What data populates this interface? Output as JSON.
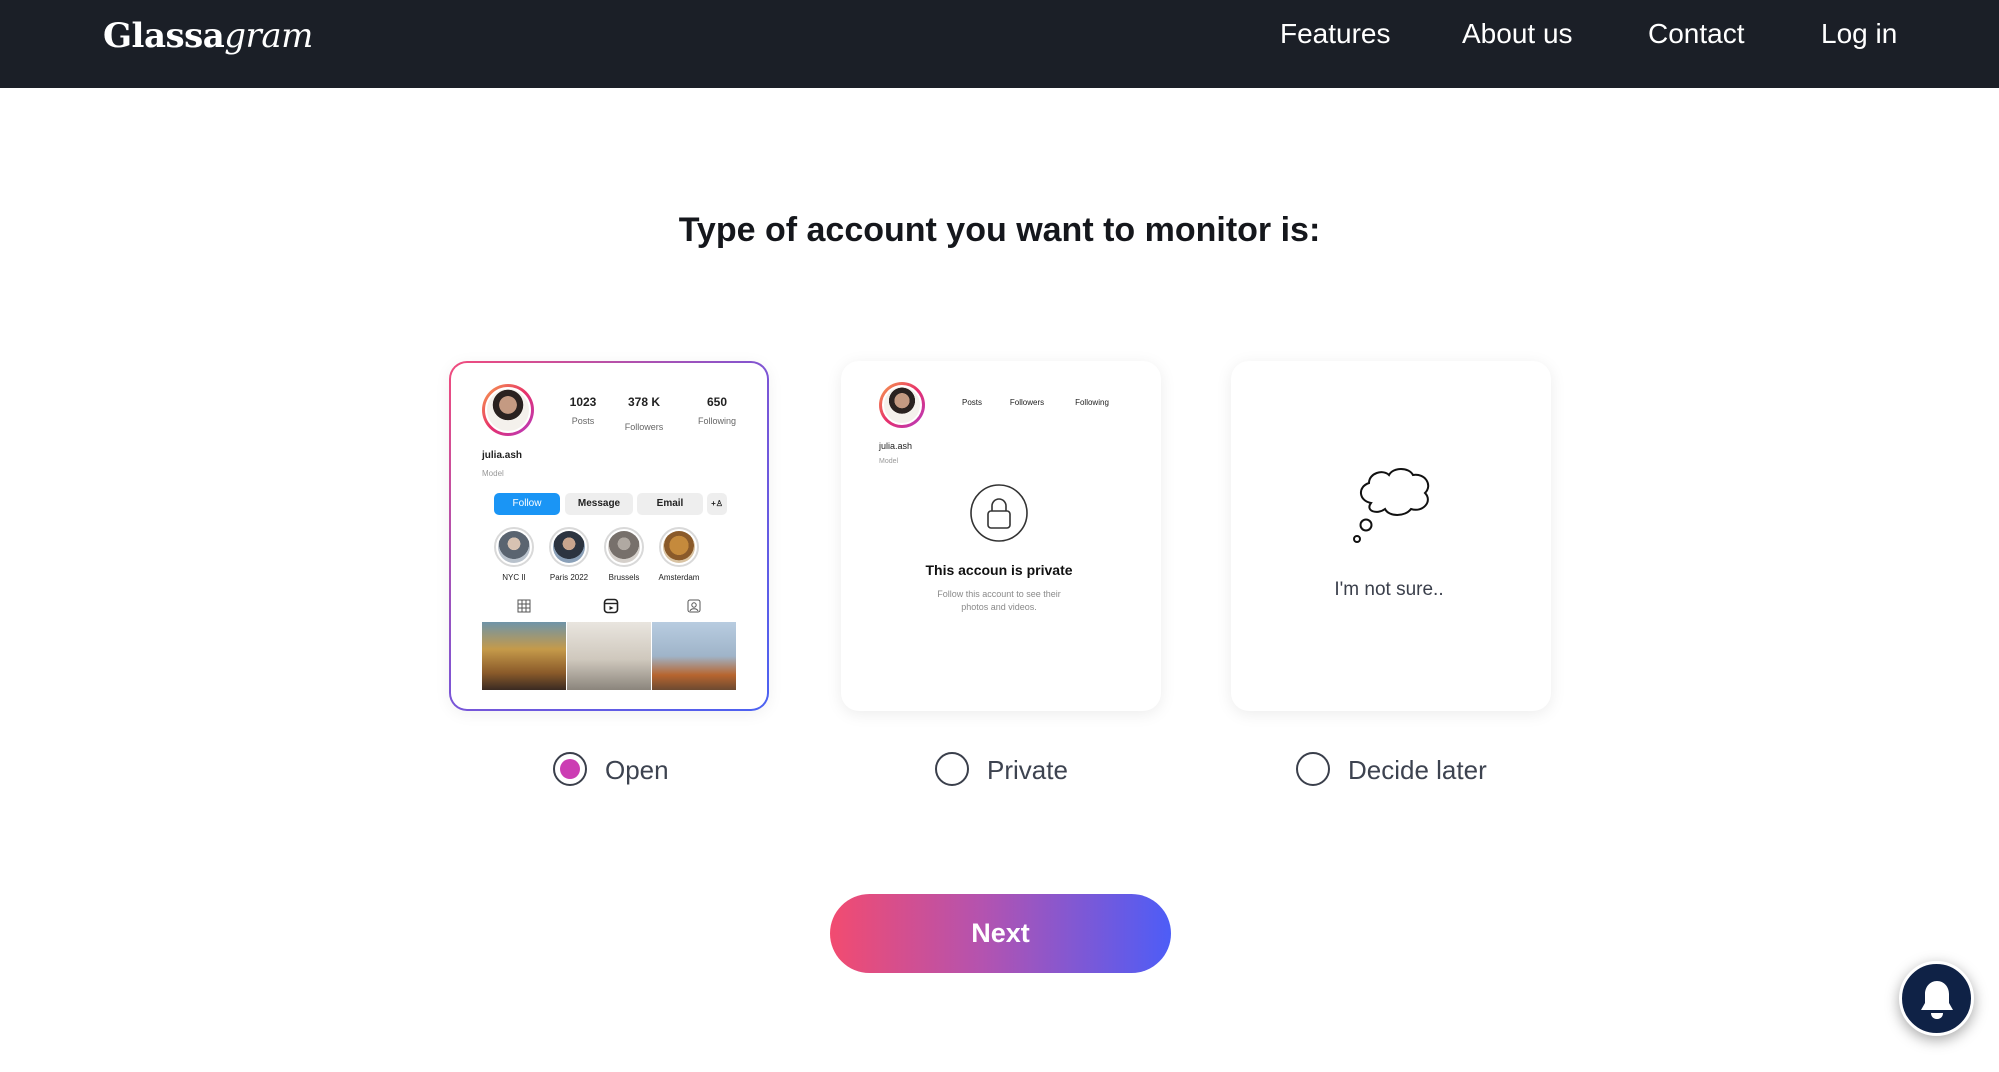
{
  "header": {
    "logo_bold": "Glassa",
    "logo_italic": "gram",
    "nav": [
      "Features",
      "About us",
      "Contact",
      "Log in"
    ]
  },
  "title": "Type of account you want to monitor is:",
  "open_card": {
    "posts": "1023",
    "posts_label": "Posts",
    "followers": "378 K",
    "followers_label": "Followers",
    "following": "650",
    "following_label": "Following",
    "username": "julia.ash",
    "bio": "Model",
    "buttons": [
      "Follow",
      "Message",
      "Email"
    ],
    "highlights": [
      "NYC II",
      "Paris 2022",
      "Brussels",
      "Amsterdam"
    ]
  },
  "private_card": {
    "posts_label": "Posts",
    "followers_label": "Followers",
    "following_label": "Following",
    "username": "julia.ash",
    "bio": "Model",
    "private_title": "This accoun is private",
    "private_subtitle_1": "Follow this account to see their",
    "private_subtitle_2": "photos and videos."
  },
  "unsure_card": {
    "text": "I'm not sure.."
  },
  "options": [
    {
      "label": "Open",
      "checked": true
    },
    {
      "label": "Private",
      "checked": false
    },
    {
      "label": "Decide later",
      "checked": false
    }
  ],
  "next_label": "Next",
  "colors": {
    "header_bg": "#1b1f27",
    "radio_selected": "#cc3db3",
    "gradient_start": "#f24b70",
    "gradient_end": "#4d5df7",
    "bell_bg": "#0f2246",
    "follow_blue": "#1a95f5"
  },
  "icons": {
    "notifications": "bell-icon",
    "private": "lock-icon",
    "unsure": "thought-cloud-icon"
  }
}
